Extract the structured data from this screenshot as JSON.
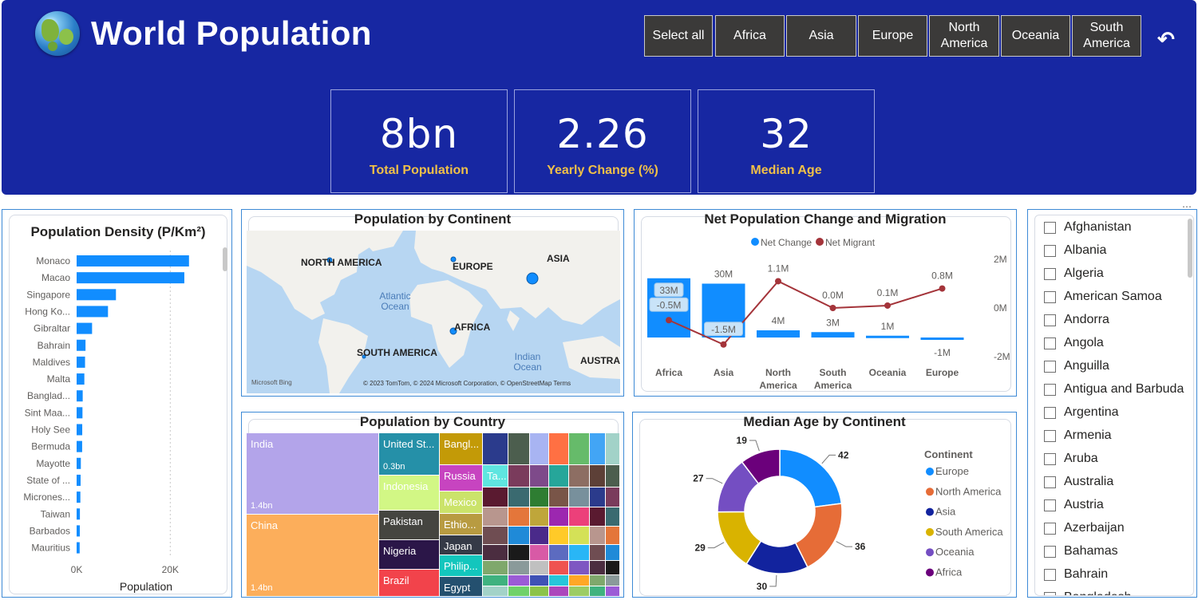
{
  "header": {
    "title": "World Population",
    "slicer": [
      "Select all",
      "Africa",
      "Asia",
      "Europe",
      "North America",
      "Oceania",
      "South America"
    ],
    "reset_icon": "undo-icon",
    "globe_icon": "globe-icon"
  },
  "kpis": [
    {
      "value": "8bn",
      "label": "Total Population"
    },
    {
      "value": "2.26",
      "label": "Yearly Change (%)"
    },
    {
      "value": "32",
      "label": "Median Age"
    }
  ],
  "colors": {
    "header_bg": "#1727a2",
    "accent": "#118dff",
    "kpi_label": "#f0c048",
    "migrant_line": "#a4343a"
  },
  "density": {
    "title": "Population Density (P/Km²)",
    "xlabel": "Population",
    "ticks": [
      "0K",
      "20K"
    ]
  },
  "continent_map": {
    "title": "Population by Continent",
    "labels": [
      "NORTH AMERICA",
      "EUROPE",
      "ASIA",
      "AFRICA",
      "SOUTH AMERICA",
      "AUSTRAL"
    ],
    "oceans": [
      "Atlantic Ocean",
      "Indian Ocean"
    ],
    "logo": "Microsoft Bing",
    "attribution": "© 2023 TomTom, © 2024 Microsoft Corporation, © OpenStreetMap  Terms"
  },
  "net_change": {
    "title": "Net Population Change and Migration",
    "legend": [
      "Net Change",
      "Net Migrant"
    ],
    "right_ticks": [
      "2M",
      "0M",
      "-2M"
    ]
  },
  "treemap": {
    "title": "Population by Country",
    "tiles": [
      {
        "label": "India",
        "sub": "1.4bn"
      },
      {
        "label": "China",
        "sub": "1.4bn"
      },
      {
        "label": "United St...",
        "sub": "0.3bn"
      },
      {
        "label": "Indonesia"
      },
      {
        "label": "Pakistan"
      },
      {
        "label": "Nigeria"
      },
      {
        "label": "Brazil"
      },
      {
        "label": "Bangl..."
      },
      {
        "label": "Russia"
      },
      {
        "label": "Ta..."
      },
      {
        "label": "Mexico"
      },
      {
        "label": "Ethio..."
      },
      {
        "label": "Japan"
      },
      {
        "label": "Philip..."
      },
      {
        "label": "Egypt"
      }
    ]
  },
  "median_age": {
    "title": "Median Age by Continent",
    "legend_title": "Continent"
  },
  "countries": {
    "items": [
      "Afghanistan",
      "Albania",
      "Algeria",
      "American Samoa",
      "Andorra",
      "Angola",
      "Anguilla",
      "Antigua and Barbuda",
      "Argentina",
      "Armenia",
      "Aruba",
      "Australia",
      "Austria",
      "Azerbaijan",
      "Bahamas",
      "Bahrain",
      "Bangladesh"
    ]
  },
  "chart_data": [
    {
      "type": "bar",
      "title": "Population Density (P/Km²)",
      "xlabel": "Population",
      "categories": [
        "Monaco",
        "Macao",
        "Singapore",
        "Hong Ko...",
        "Gibraltar",
        "Bahrain",
        "Maldives",
        "Malta",
        "Banglad...",
        "Sint Maa...",
        "Holy See",
        "Bermuda",
        "Mayotte",
        "State of ...",
        "Micrones...",
        "Taiwan",
        "Barbados",
        "Mauritius"
      ],
      "values": [
        24000,
        23000,
        8400,
        6700,
        3300,
        1900,
        1800,
        1650,
        1300,
        1250,
        1200,
        1180,
        900,
        850,
        800,
        700,
        680,
        650
      ],
      "xlim": [
        0,
        30000
      ],
      "ticks": [
        0,
        20000
      ]
    },
    {
      "type": "bar",
      "title": "Net Population Change and Migration",
      "categories": [
        "Africa",
        "Asia",
        "North America",
        "South America",
        "Oceania",
        "Europe"
      ],
      "series": [
        {
          "name": "Net Change",
          "values": [
            33,
            30,
            4,
            3,
            1,
            -1
          ],
          "labels": [
            "33M",
            "30M",
            "4M",
            "3M",
            "1M",
            "-1M"
          ]
        },
        {
          "name": "Net Migrant",
          "values": [
            -0.5,
            -1.5,
            1.1,
            0.0,
            0.1,
            0.8
          ],
          "labels": [
            "-0.5M",
            "-1.5M",
            "1.1M",
            "0.0M",
            "0.1M",
            "0.8M"
          ]
        }
      ],
      "y2_ticks": [
        "2M",
        "0M",
        "-2M"
      ]
    },
    {
      "type": "pie",
      "title": "Median Age by Continent",
      "legend_title": "Continent",
      "categories": [
        "Europe",
        "North America",
        "Asia",
        "South America",
        "Oceania",
        "Africa"
      ],
      "values": [
        42,
        36,
        30,
        29,
        27,
        19
      ],
      "colors": [
        "#118dff",
        "#e66c37",
        "#12239e",
        "#d9b300",
        "#744ec2",
        "#6b007b"
      ]
    }
  ]
}
